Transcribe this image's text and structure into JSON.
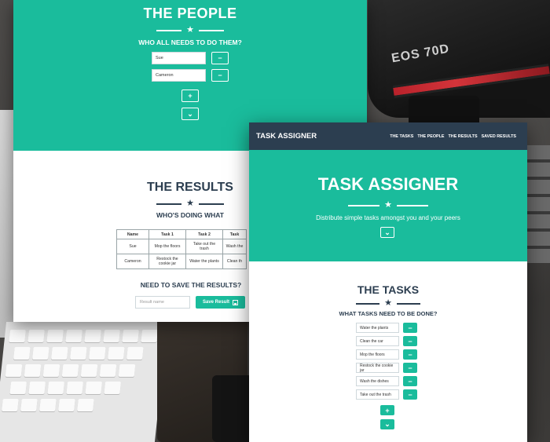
{
  "background": {
    "camera_label": "EOS 70D"
  },
  "people_window": {
    "title": "THE PEOPLE",
    "subtitle": "WHO ALL NEEDS TO DO THEM?",
    "people": [
      {
        "name": "Sue",
        "remove_icon": "minus-icon"
      },
      {
        "name": "Cameron",
        "remove_icon": "minus-icon"
      }
    ],
    "add_icon": "plus-icon",
    "next_icon": "chevron-down-icon",
    "results": {
      "title": "THE RESULTS",
      "subtitle": "WHO'S DOING WHAT",
      "table": {
        "headers": [
          "Name",
          "Task 1",
          "Task 2",
          "Task"
        ],
        "rows": [
          [
            "Sue",
            "Mop the floors",
            "Take out the trash",
            "Wash the"
          ],
          [
            "Cameron",
            "Restock the cookie jar",
            "Water the plants",
            "Clean th"
          ]
        ]
      },
      "save_question": "NEED TO SAVE THE RESULTS?",
      "save_placeholder": "Result name",
      "save_button": "Save Result",
      "save_icon": "floppy-disk-icon"
    }
  },
  "tasks_window": {
    "brand": "TASK ASSIGNER",
    "nav": [
      "THE TASKS",
      "THE PEOPLE",
      "THE RESULTS",
      "SAVED RESULTS"
    ],
    "hero": {
      "title": "TASK ASSIGNER",
      "subtitle": "Distribute simple tasks amongst you and your peers",
      "next_icon": "chevron-down-icon"
    },
    "tasks": {
      "title": "THE TASKS",
      "subtitle": "WHAT TASKS NEED TO BE DONE?",
      "items": [
        "Water the plants",
        "Clean the car",
        "Mop the floors",
        "Restock the cookie jar",
        "Wash the dishes",
        "Take out the trash"
      ],
      "add_icon": "plus-icon",
      "next_icon": "chevron-down-icon"
    }
  },
  "colors": {
    "accent": "#1abc9c",
    "dark": "#2c3e50"
  }
}
